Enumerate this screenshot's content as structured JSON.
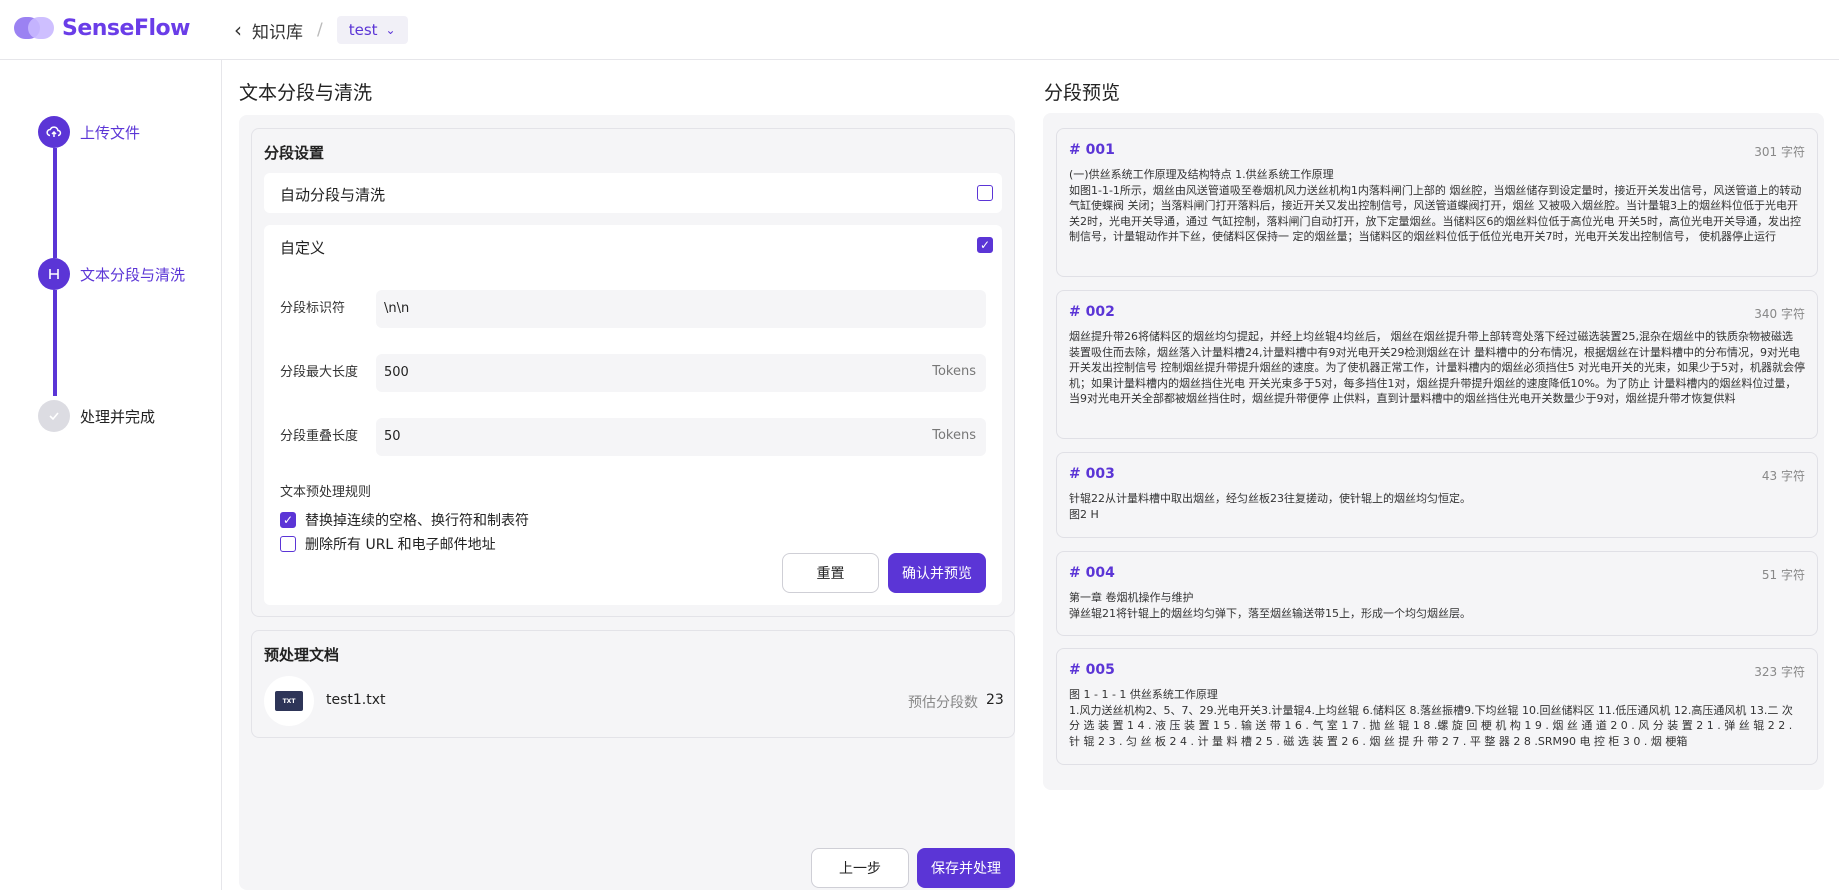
{
  "app": {
    "name": "SenseFlow"
  },
  "breadcrumb": {
    "back_icon": "chevron-left-icon",
    "parent": "知识库",
    "separator": "/",
    "current": "test"
  },
  "steps": [
    {
      "label": "上传文件",
      "icon": "cloud-upload-icon",
      "state": "done"
    },
    {
      "label": "文本分段与清洗",
      "icon": "segment-icon",
      "state": "active"
    },
    {
      "label": "处理并完成",
      "icon": "check-icon",
      "state": "pending"
    }
  ],
  "left": {
    "title": "文本分段与清洗",
    "settings_title": "分段设置",
    "auto_option": {
      "label": "自动分段与清洗",
      "checked": false
    },
    "custom_option": {
      "label": "自定义",
      "checked": true
    },
    "separator": {
      "label": "分段标识符",
      "value": "\\n\\n"
    },
    "max_length": {
      "label": "分段最大长度",
      "value": "500",
      "unit": "Tokens"
    },
    "overlap": {
      "label": "分段重叠长度",
      "value": "50",
      "unit": "Tokens"
    },
    "rules_title": "文本预处理规则",
    "rules": [
      {
        "label": "替换掉连续的空格、换行符和制表符",
        "checked": true
      },
      {
        "label": "删除所有 URL 和电子邮件地址",
        "checked": false
      }
    ],
    "reset_label": "重置",
    "confirm_label": "确认并预览",
    "docs_title": "预处理文档",
    "doc": {
      "file_badge": "TXT",
      "name": "test1.txt",
      "estimate_label": "预估分段数",
      "estimate_value": "23"
    },
    "prev_label": "上一步",
    "save_label": "保存并处理"
  },
  "preview": {
    "title": "分段预览",
    "segments": [
      {
        "id": "# 001",
        "count": "301 字符",
        "text": "(一)供丝系统工作原理及结构特点 1.供丝系统工作原理\n如图1-1-1所示，烟丝由风送管道吸至卷烟机风力送丝机构1内落料闸门上部的 烟丝腔，当烟丝储存到设定量时，接近开关发出信号，风送管道上的转动气缸使蝶阀 关闭；当落料闸门打开落料后，接近开关又发出控制信号，风送管道蝶阀打开，烟丝 又被吸入烟丝腔。当计量辊3上的烟丝料位低于光电开关2时，光电开关导通，通过 气缸控制，落料闸门自动打开，放下定量烟丝。当储料区6的烟丝料位低于高位光电 开关5时，高位光电开关导通，发出控制信号，计量辊动作并下丝，使储料区保持一 定的烟丝量；当储料区的烟丝料位低于低位光电开关7时，光电开关发出控制信号， 使机器停止运行"
      },
      {
        "id": "# 002",
        "count": "340 字符",
        "text": "烟丝提升带26将储料区的烟丝均匀提起，并经上均丝辊4均丝后， 烟丝在烟丝提升带上部转弯处落下经过磁选装置25,混杂在烟丝中的铁质杂物被磁选 装置吸住而去除，烟丝落入计量料槽24,计量料槽中有9对光电开关29检测烟丝在计 量料槽中的分布情况，根据烟丝在计量料槽中的分布情况，9对光电开关发出控制信号 控制烟丝提升带提升烟丝的速度。为了使机器正常工作，计量料槽内的烟丝必须挡住5 对光电开关的光束，如果少于5对，机器就会停机；如果计量料槽内的烟丝挡住光电 开关光束多于5对，每多挡住1对，烟丝提升带提升烟丝的速度降低10%。为了防止 计量料槽内的烟丝料位过量，当9对光电开关全部都被烟丝挡住时，烟丝提升带便停 止供料，直到计量料槽中的烟丝挡住光电开关数量少于9对，烟丝提升带才恢复供料"
      },
      {
        "id": "# 003",
        "count": "43 字符",
        "text": "针辊22从计量料槽中取出烟丝，经匀丝板23往复搓动，使针辊上的烟丝均匀恒定。\n图2 H"
      },
      {
        "id": "# 004",
        "count": "51 字符",
        "text": "第一章 卷烟机操作与维护\n弹丝辊21将针辊上的烟丝均匀弹下，落至烟丝输送带15上，形成一个均匀烟丝层。"
      },
      {
        "id": "# 005",
        "count": "323 字符",
        "text": "图 1 - 1 - 1 供丝系统工作原理\n1.风力送丝机构2、5、7、29.光电开关3.计量辊4.上均丝辊 6.储料区 8.落丝振槽9.下均丝辊 10.回丝储料区 11.低压通风机 12.高压通风机 13.二 次 分 选 装 置 1 4 . 液 压 装 置 1 5 . 输 送 带 1 6 . 气 室 1 7 . 抛 丝 辊 1 8 .螺 旋 回 梗 机 构 1 9 . 烟 丝 通 道 2 0 . 风 分 装 置 2 1 . 弹 丝 辊 2 2 . 针 辊 2 3 . 匀 丝 板 2 4 . 计 量 料 槽 2 5 . 磁 选 装 置 2 6 . 烟 丝 提 升 带 2 7 . 平 整 器 2 8 .SRM90 电 控 柜 3 0 . 烟 梗箱"
      }
    ]
  },
  "colors": {
    "accent": "#5b35d6",
    "accent_light": "#8a6cf0",
    "step_pending": "#dcdce2",
    "panel_bg": "#f5f5f7"
  }
}
